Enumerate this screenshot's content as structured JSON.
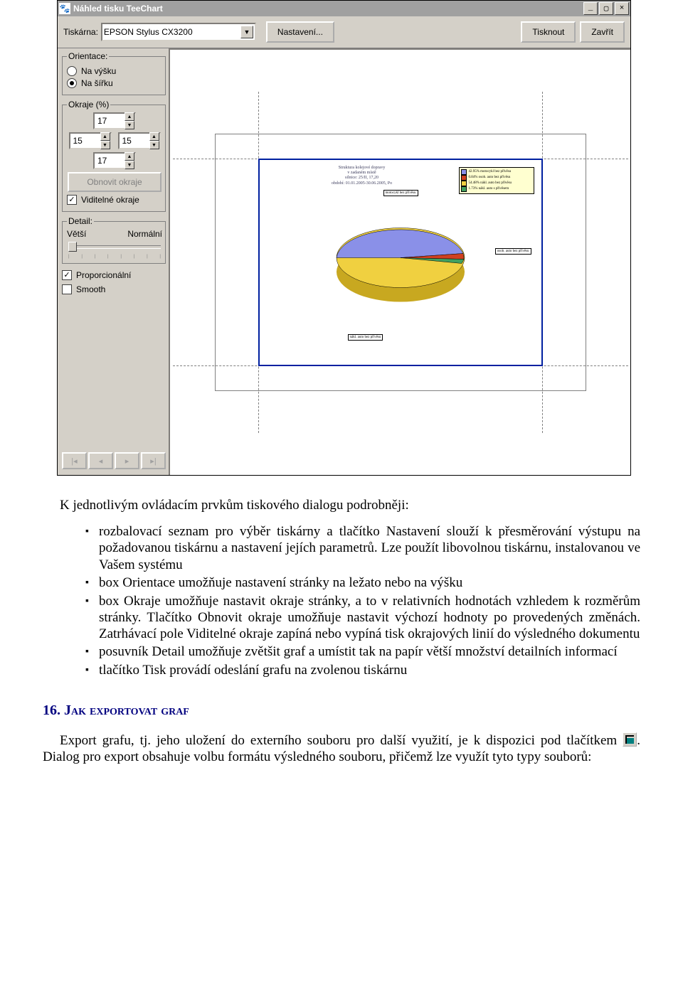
{
  "window": {
    "title": "Náhled tisku TeeChart",
    "printer_label": "Tiskárna:",
    "printer_value": "EPSON Stylus CX3200",
    "btn_settings": "Nastavení...",
    "btn_print": "Tisknout",
    "btn_close": "Zavřít"
  },
  "panel": {
    "orientation_legend": "Orientace:",
    "orientation_portrait": "Na výšku",
    "orientation_landscape": "Na šířku",
    "margins_legend": "Okraje (%)",
    "margin_top": "17",
    "margin_left": "15",
    "margin_right": "15",
    "margin_bottom": "17",
    "btn_reset_margins": "Obnovit okraje",
    "check_visible_margins": "Viditelné okraje",
    "detail_legend": "Detail:",
    "detail_left": "Větší",
    "detail_right": "Normální",
    "check_proportional": "Proporcionální",
    "check_smooth": "Smooth"
  },
  "chart_data": {
    "type": "pie",
    "title_lines": [
      "Struktura kolejové dopravy",
      "v zadaném místě",
      "silnice: 25/II, 17,20",
      "období: 01.01.2005-30.06.2005, Po"
    ],
    "series": [
      {
        "name": "42.95% motocykl bez přívěsu",
        "value": 42.95,
        "color": "#8a90e8"
      },
      {
        "name": "0.84% osob. auto bez přívěsu",
        "value": 0.84,
        "color": "#d04020"
      },
      {
        "name": "54.48% nákl. auto bez přívěsu",
        "value": 54.48,
        "color": "#f0d040"
      },
      {
        "name": "1.73% nákl. auto s přívěsem",
        "value": 1.73,
        "color": "#40a060"
      }
    ],
    "callouts": [
      {
        "label": "motocykl bez přívěsu",
        "pos": "top"
      },
      {
        "label": "osob. auto bez přívěsu",
        "pos": "right"
      },
      {
        "label": "nákl. auto bez přívěsu",
        "pos": "bottom"
      }
    ]
  },
  "doc": {
    "intro": "K jednotlivým ovládacím prvkům tiskového dialogu podrobněji:",
    "b1": "rozbalovací seznam pro výběr tiskárny a tlačítko Nastavení slouží k přesměrování výstupu na požadovanou tiskárnu a nastavení jejích parametrů. Lze použít libovolnou tiskárnu, instalovanou ve Vašem systému",
    "b2": "box Orientace umožňuje nastavení stránky na ležato nebo na výšku",
    "b3": "box Okraje umožňuje nastavit okraje stránky, a to v relativních hodnotách vzhledem k rozměrům stránky. Tlačítko Obnovit okraje umožňuje nastavit výchozí hodnoty po provedených změnách. Zatrhávací pole Viditelné okraje zapíná nebo vypíná tisk okrajových linií do výsledného dokumentu",
    "b4": "posuvník Detail umožňuje zvětšit graf a umístit tak na papír větší množství detailních informací",
    "b5": "tlačítko Tisk provádí odeslání grafu na zvolenou tiskárnu",
    "section_num": "16.",
    "section_title": " Jak exportovat graf",
    "p_export_a": "Export grafu, tj. jeho uložení do externího souboru pro další využití, je k dispozici pod tlačítkem ",
    "p_export_b": ". Dialog pro export obsahuje volbu formátu výsledného souboru, přičemž lze využít tyto typy souborů:"
  }
}
